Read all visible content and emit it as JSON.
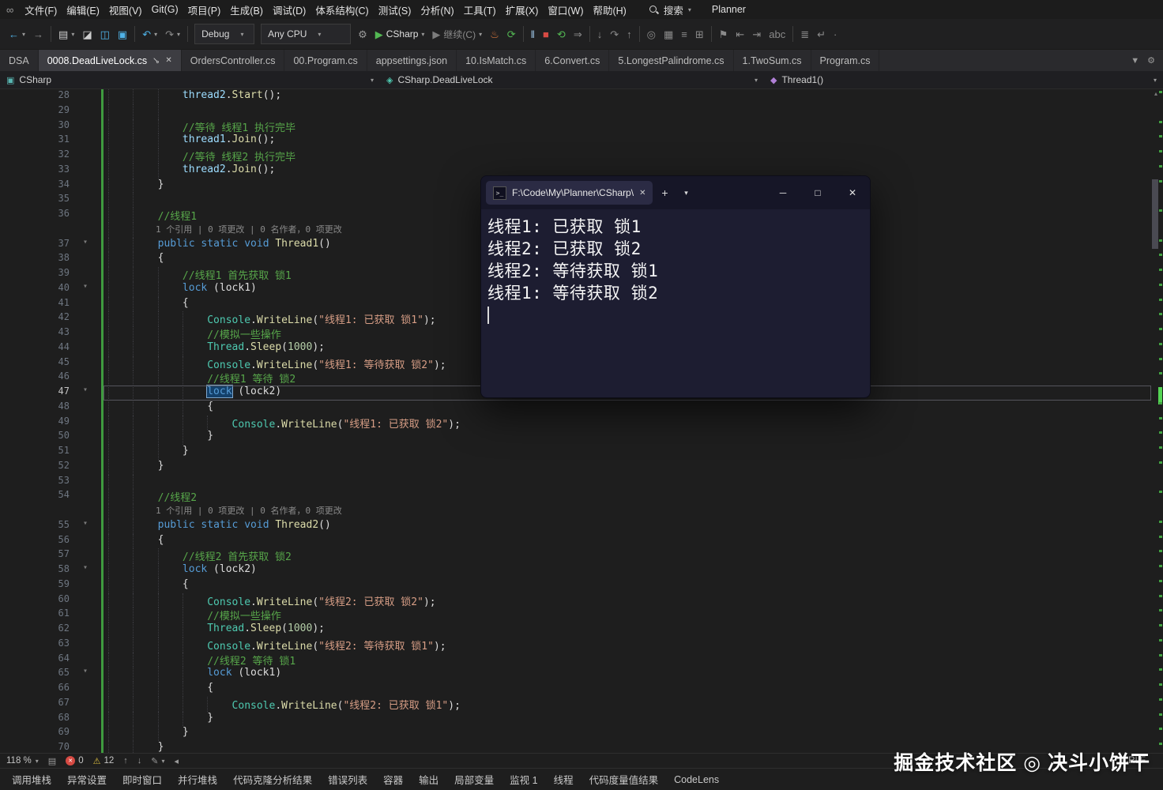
{
  "menubar": {
    "items": [
      "文件(F)",
      "编辑(E)",
      "视图(V)",
      "Git(G)",
      "项目(P)",
      "生成(B)",
      "调试(D)",
      "体系结构(C)",
      "测试(S)",
      "分析(N)",
      "工具(T)",
      "扩展(X)",
      "窗口(W)",
      "帮助(H)"
    ],
    "search_label": "搜索",
    "solution": "Planner"
  },
  "toolbar": {
    "items": [
      {
        "name": "navigate-back-button",
        "glyph": "←",
        "color": "#4fb3e8",
        "caret": true
      },
      {
        "name": "navigate-forward-button",
        "glyph": "→",
        "color": "#8a8a8a"
      },
      {
        "sep": true
      },
      {
        "name": "new-file-button",
        "glyph": "▤",
        "color": "#cfcfcf",
        "caret": true
      },
      {
        "name": "open-file-button",
        "glyph": "◪",
        "color": "#cfcfcf"
      },
      {
        "name": "save-button",
        "glyph": "◫",
        "color": "#4fb3e8"
      },
      {
        "name": "save-all-button",
        "glyph": "▣",
        "color": "#4fb3e8"
      },
      {
        "sep": true
      },
      {
        "name": "undo-button",
        "glyph": "↶",
        "color": "#4fb3e8",
        "caret": true
      },
      {
        "name": "redo-button",
        "glyph": "↷",
        "color": "#8a8a8a",
        "caret": true
      },
      {
        "sep": true
      },
      {
        "kind": "select",
        "name": "configuration-select",
        "label": "Debug"
      },
      {
        "kind": "select",
        "name": "platform-select",
        "label": "Any CPU",
        "wide": true
      },
      {
        "name": "debug-target-gear",
        "glyph": "⚙",
        "color": "#9a9a9a"
      },
      {
        "name": "start-debug-button",
        "glyph": "▶",
        "color": "#53b853",
        "label": "CSharp",
        "labelColor": "#e0e0e0",
        "caret": true
      },
      {
        "name": "continue-button",
        "glyph": "▶",
        "color": "#7c7c7c",
        "label": "继续(C)",
        "labelColor": "#8a8a8a",
        "caret": true
      },
      {
        "name": "hot-reload-button",
        "glyph": "♨",
        "color": "#d9763c"
      },
      {
        "name": "restart-app-button",
        "glyph": "⟳",
        "color": "#53b853"
      },
      {
        "sep": true
      },
      {
        "name": "break-all-button",
        "glyph": "‖",
        "color": "#9fc7e8"
      },
      {
        "name": "stop-debug-button",
        "glyph": "■",
        "color": "#d64a43"
      },
      {
        "name": "restart-debug-button",
        "glyph": "⟲",
        "color": "#53b853"
      },
      {
        "name": "show-next-statement-button",
        "glyph": "⇒",
        "color": "#8a8a8a"
      },
      {
        "sep": true
      },
      {
        "name": "step-into-button",
        "glyph": "↓",
        "color": "#8a8a8a"
      },
      {
        "name": "step-over-button",
        "glyph": "↷",
        "color": "#8a8a8a"
      },
      {
        "name": "step-out-button",
        "glyph": "↑",
        "color": "#8a8a8a"
      },
      {
        "sep": true
      },
      {
        "name": "find-in-files-button",
        "glyph": "◎",
        "color": "#8a8a8a"
      },
      {
        "name": "solution-explorer-button",
        "glyph": "▦",
        "color": "#8a8a8a"
      },
      {
        "name": "properties-button",
        "glyph": "≡",
        "color": "#8a8a8a"
      },
      {
        "name": "toolbox-button",
        "glyph": "⊞",
        "color": "#8a8a8a"
      },
      {
        "sep": true
      },
      {
        "name": "bookmark-button",
        "glyph": "⚑",
        "color": "#8a8a8a"
      },
      {
        "name": "prev-bookmark-button",
        "glyph": "⇤",
        "color": "#8a8a8a"
      },
      {
        "name": "next-bookmark-button",
        "glyph": "⇥",
        "color": "#8a8a8a"
      },
      {
        "name": "spell-check-button",
        "glyph": "abc",
        "color": "#8a8a8a"
      },
      {
        "sep": true
      },
      {
        "name": "indent-guides-button",
        "glyph": "≣",
        "color": "#8a8a8a"
      },
      {
        "name": "word-wrap-button",
        "glyph": "↵",
        "color": "#8a8a8a"
      },
      {
        "name": "whitespace-button",
        "glyph": "·",
        "color": "#8a8a8a"
      }
    ]
  },
  "tabs": {
    "items": [
      {
        "label": "DSA"
      },
      {
        "label": "0008.DeadLiveLock.cs",
        "active": true
      },
      {
        "label": "OrdersController.cs"
      },
      {
        "label": "00.Program.cs"
      },
      {
        "label": "appsettings.json"
      },
      {
        "label": "10.IsMatch.cs"
      },
      {
        "label": "6.Convert.cs"
      },
      {
        "label": "5.LongestPalindrome.cs"
      },
      {
        "label": "1.TwoSum.cs"
      },
      {
        "label": "Program.cs"
      }
    ]
  },
  "breadcrumb": {
    "segments": [
      {
        "label": "CSharp",
        "icon": "project-icon",
        "glyph": "▣",
        "color": "#59b6b2"
      },
      {
        "label": "CSharp.DeadLiveLock",
        "icon": "class-icon",
        "glyph": "◈",
        "color": "#4ec9b0"
      },
      {
        "label": "Thread1()",
        "icon": "method-icon",
        "glyph": "◆",
        "color": "#b180d7"
      }
    ]
  },
  "editor": {
    "lines": [
      {
        "n": 28,
        "seg": [
          [
            "pl",
            "            "
          ],
          [
            "var",
            "thread2"
          ],
          [
            "pl",
            "."
          ],
          [
            "mt",
            "Start"
          ],
          [
            "pl",
            "();"
          ]
        ]
      },
      {
        "n": 29,
        "seg": []
      },
      {
        "n": 30,
        "seg": [
          [
            "pl",
            "            "
          ],
          [
            "cm",
            "//等待 线程1 执行完毕"
          ]
        ]
      },
      {
        "n": 31,
        "seg": [
          [
            "pl",
            "            "
          ],
          [
            "var",
            "thread1"
          ],
          [
            "pl",
            "."
          ],
          [
            "mt",
            "Join"
          ],
          [
            "pl",
            "();"
          ]
        ]
      },
      {
        "n": 32,
        "seg": [
          [
            "pl",
            "            "
          ],
          [
            "cm",
            "//等待 线程2 执行完毕"
          ]
        ]
      },
      {
        "n": 33,
        "seg": [
          [
            "pl",
            "            "
          ],
          [
            "var",
            "thread2"
          ],
          [
            "pl",
            "."
          ],
          [
            "mt",
            "Join"
          ],
          [
            "pl",
            "();"
          ]
        ]
      },
      {
        "n": 34,
        "seg": [
          [
            "pl",
            "        }"
          ]
        ]
      },
      {
        "n": 35,
        "seg": []
      },
      {
        "n": 36,
        "seg": [
          [
            "pl",
            "        "
          ],
          [
            "cm",
            "//线程1"
          ]
        ]
      },
      {
        "codelens": true,
        "indent": 8,
        "text": "1 个引用 | 0 项更改 | 0 名作者，0 项更改"
      },
      {
        "n": 37,
        "fold": 1,
        "seg": [
          [
            "pl",
            "        "
          ],
          [
            "kw",
            "public"
          ],
          [
            "pl",
            " "
          ],
          [
            "kw",
            "static"
          ],
          [
            "pl",
            " "
          ],
          [
            "kw",
            "void"
          ],
          [
            "pl",
            " "
          ],
          [
            "mt",
            "Thread1"
          ],
          [
            "pl",
            "()"
          ]
        ]
      },
      {
        "n": 38,
        "seg": [
          [
            "pl",
            "        {"
          ]
        ]
      },
      {
        "n": 39,
        "seg": [
          [
            "pl",
            "            "
          ],
          [
            "cm",
            "//线程1 首先获取 锁1"
          ]
        ]
      },
      {
        "n": 40,
        "fold": 1,
        "seg": [
          [
            "pl",
            "            "
          ],
          [
            "kw",
            "lock"
          ],
          [
            "pl",
            " ("
          ],
          [
            "pl",
            "lock1"
          ],
          [
            "pl",
            ")"
          ]
        ]
      },
      {
        "n": 41,
        "seg": [
          [
            "pl",
            "            {"
          ]
        ]
      },
      {
        "n": 42,
        "seg": [
          [
            "pl",
            "                "
          ],
          [
            "cl",
            "Console"
          ],
          [
            "pl",
            "."
          ],
          [
            "mt",
            "WriteLine"
          ],
          [
            "pl",
            "("
          ],
          [
            "st",
            "\"线程1: 已获取 锁1\""
          ],
          [
            "pl",
            ");"
          ]
        ]
      },
      {
        "n": 43,
        "seg": [
          [
            "pl",
            "                "
          ],
          [
            "cm",
            "//模拟一些操作"
          ]
        ]
      },
      {
        "n": 44,
        "seg": [
          [
            "pl",
            "                "
          ],
          [
            "cl",
            "Thread"
          ],
          [
            "pl",
            "."
          ],
          [
            "mt",
            "Sleep"
          ],
          [
            "pl",
            "("
          ],
          [
            "num",
            "1000"
          ],
          [
            "pl",
            ");"
          ]
        ]
      },
      {
        "n": 45,
        "seg": [
          [
            "pl",
            "                "
          ],
          [
            "cl",
            "Console"
          ],
          [
            "pl",
            "."
          ],
          [
            "mt",
            "WriteLine"
          ],
          [
            "pl",
            "("
          ],
          [
            "st",
            "\"线程1: 等待获取 锁2\""
          ],
          [
            "pl",
            ");"
          ]
        ]
      },
      {
        "n": 46,
        "seg": [
          [
            "pl",
            "                "
          ],
          [
            "cm",
            "//线程1 等待 锁2"
          ]
        ]
      },
      {
        "n": 47,
        "cur": 1,
        "fold": 1,
        "seg": [
          [
            "pl",
            "                "
          ],
          [
            "kwsel",
            "lock"
          ],
          [
            "pl",
            " ("
          ],
          [
            "pl",
            "lock2"
          ],
          [
            "pl",
            ")"
          ]
        ]
      },
      {
        "n": 48,
        "seg": [
          [
            "pl",
            "                {"
          ]
        ]
      },
      {
        "n": 49,
        "seg": [
          [
            "pl",
            "                    "
          ],
          [
            "cl",
            "Console"
          ],
          [
            "pl",
            "."
          ],
          [
            "mt",
            "WriteLine"
          ],
          [
            "pl",
            "("
          ],
          [
            "st",
            "\"线程1: 已获取 锁2\""
          ],
          [
            "pl",
            ");"
          ]
        ]
      },
      {
        "n": 50,
        "seg": [
          [
            "pl",
            "                }"
          ]
        ]
      },
      {
        "n": 51,
        "seg": [
          [
            "pl",
            "            }"
          ]
        ]
      },
      {
        "n": 52,
        "seg": [
          [
            "pl",
            "        }"
          ]
        ]
      },
      {
        "n": 53,
        "seg": []
      },
      {
        "n": 54,
        "seg": [
          [
            "pl",
            "        "
          ],
          [
            "cm",
            "//线程2"
          ]
        ]
      },
      {
        "codelens": true,
        "indent": 8,
        "text": "1 个引用 | 0 项更改 | 0 名作者，0 项更改"
      },
      {
        "n": 55,
        "fold": 1,
        "seg": [
          [
            "pl",
            "        "
          ],
          [
            "kw",
            "public"
          ],
          [
            "pl",
            " "
          ],
          [
            "kw",
            "static"
          ],
          [
            "pl",
            " "
          ],
          [
            "kw",
            "void"
          ],
          [
            "pl",
            " "
          ],
          [
            "mt",
            "Thread2"
          ],
          [
            "pl",
            "()"
          ]
        ]
      },
      {
        "n": 56,
        "seg": [
          [
            "pl",
            "        {"
          ]
        ]
      },
      {
        "n": 57,
        "seg": [
          [
            "pl",
            "            "
          ],
          [
            "cm",
            "//线程2 首先获取 锁2"
          ]
        ]
      },
      {
        "n": 58,
        "fold": 1,
        "seg": [
          [
            "pl",
            "            "
          ],
          [
            "kw",
            "lock"
          ],
          [
            "pl",
            " ("
          ],
          [
            "pl",
            "lock2"
          ],
          [
            "pl",
            ")"
          ]
        ]
      },
      {
        "n": 59,
        "seg": [
          [
            "pl",
            "            {"
          ]
        ]
      },
      {
        "n": 60,
        "seg": [
          [
            "pl",
            "                "
          ],
          [
            "cl",
            "Console"
          ],
          [
            "pl",
            "."
          ],
          [
            "mt",
            "WriteLine"
          ],
          [
            "pl",
            "("
          ],
          [
            "st",
            "\"线程2: 已获取 锁2\""
          ],
          [
            "pl",
            ");"
          ]
        ]
      },
      {
        "n": 61,
        "seg": [
          [
            "pl",
            "                "
          ],
          [
            "cm",
            "//模拟一些操作"
          ]
        ]
      },
      {
        "n": 62,
        "seg": [
          [
            "pl",
            "                "
          ],
          [
            "cl",
            "Thread"
          ],
          [
            "pl",
            "."
          ],
          [
            "mt",
            "Sleep"
          ],
          [
            "pl",
            "("
          ],
          [
            "num",
            "1000"
          ],
          [
            "pl",
            ");"
          ]
        ]
      },
      {
        "n": 63,
        "seg": [
          [
            "pl",
            "                "
          ],
          [
            "cl",
            "Console"
          ],
          [
            "pl",
            "."
          ],
          [
            "mt",
            "WriteLine"
          ],
          [
            "pl",
            "("
          ],
          [
            "st",
            "\"线程2: 等待获取 锁1\""
          ],
          [
            "pl",
            ");"
          ]
        ]
      },
      {
        "n": 64,
        "seg": [
          [
            "pl",
            "                "
          ],
          [
            "cm",
            "//线程2 等待 锁1"
          ]
        ]
      },
      {
        "n": 65,
        "fold": 1,
        "seg": [
          [
            "pl",
            "                "
          ],
          [
            "kw",
            "lock"
          ],
          [
            "pl",
            " ("
          ],
          [
            "pl",
            "lock1"
          ],
          [
            "pl",
            ")"
          ]
        ]
      },
      {
        "n": 66,
        "seg": [
          [
            "pl",
            "                {"
          ]
        ]
      },
      {
        "n": 67,
        "seg": [
          [
            "pl",
            "                    "
          ],
          [
            "cl",
            "Console"
          ],
          [
            "pl",
            "."
          ],
          [
            "mt",
            "WriteLine"
          ],
          [
            "pl",
            "("
          ],
          [
            "st",
            "\"线程2: 已获取 锁1\""
          ],
          [
            "pl",
            ");"
          ]
        ]
      },
      {
        "n": 68,
        "seg": [
          [
            "pl",
            "                }"
          ]
        ]
      },
      {
        "n": 69,
        "seg": [
          [
            "pl",
            "            }"
          ]
        ]
      },
      {
        "n": 70,
        "seg": [
          [
            "pl",
            "        }"
          ]
        ]
      }
    ]
  },
  "console": {
    "title": "F:\\Code\\My\\Planner\\CSharp\\",
    "lines": [
      "线程1: 已获取 锁1",
      "线程2: 已获取 锁2",
      "线程2: 等待获取 锁1",
      "线程1: 等待获取 锁2"
    ]
  },
  "statusbar": {
    "zoom": "118 %",
    "errors": "0",
    "warnings": "12",
    "line_ending": "CRLF"
  },
  "panel_tabs": {
    "items": [
      "调用堆栈",
      "异常设置",
      "即时窗口",
      "并行堆栈",
      "代码克隆分析结果",
      "错误列表",
      "容器",
      "输出",
      "局部变量",
      "监视 1",
      "线程",
      "代码度量值结果",
      "CodeLens"
    ]
  },
  "watermark": "掘金技术社区 ◎ 决斗小饼干"
}
